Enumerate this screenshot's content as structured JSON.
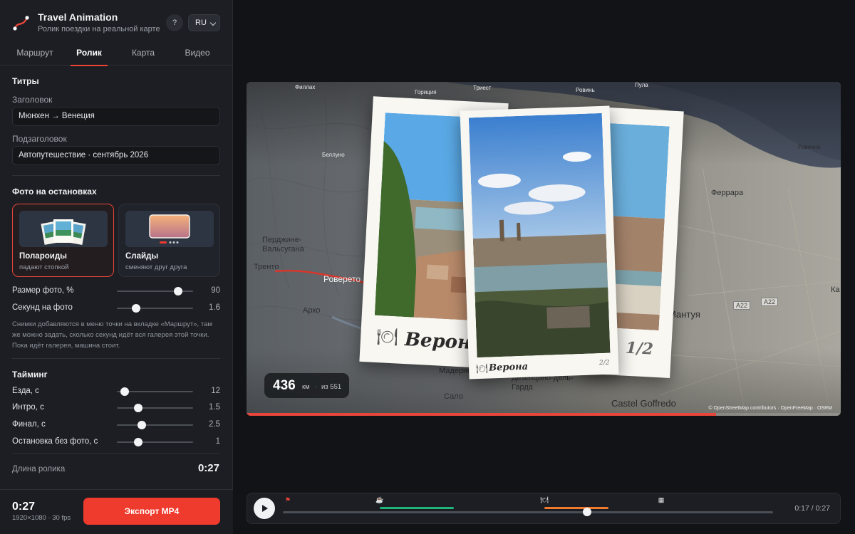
{
  "brand": {
    "title": "Travel Animation",
    "subtitle": "Ролик поездки на реальной карте",
    "help": "?",
    "lang": "RU"
  },
  "tabs": [
    {
      "label": "Маршрут",
      "active": false
    },
    {
      "label": "Ролик",
      "active": true
    },
    {
      "label": "Карта",
      "active": false
    },
    {
      "label": "Видео",
      "active": false
    }
  ],
  "titles": {
    "heading": "Титры",
    "title_label": "Заголовок",
    "title_value": "Мюнхен → Венеция",
    "subtitle_label": "Подзаголовок",
    "subtitle_value": "Автопутешествие · сентябрь 2026"
  },
  "photos": {
    "heading": "Фото на остановках",
    "modes": [
      {
        "title": "Полароиды",
        "sub": "падают стопкой",
        "selected": true
      },
      {
        "title": "Слайды",
        "sub": "сменяют друг друга",
        "selected": false
      }
    ],
    "size_label": "Размер фото, %",
    "size_value": "90",
    "size_fraction": 0.8,
    "secs_label": "Секунд на фото",
    "secs_value": "1.6",
    "secs_fraction": 0.25,
    "hint": "Снимки добавляются в меню точки на вкладке «Маршрут», там же можно задать, сколько секунд идёт вся галерея этой точки. Пока идёт галерея, машина стоит."
  },
  "timing": {
    "heading": "Тайминг",
    "rows": [
      {
        "label": "Езда, с",
        "value": "12",
        "fraction": 0.1
      },
      {
        "label": "Интро, с",
        "value": "1.5",
        "fraction": 0.28
      },
      {
        "label": "Финал, с",
        "value": "2.5",
        "fraction": 0.33
      },
      {
        "label": "Остановка без фото, с",
        "value": "1",
        "fraction": 0.28
      }
    ],
    "length_label": "Длина ролика",
    "length_value": "0:27"
  },
  "footer": {
    "time": "0:27",
    "meta": "1920×1080 · 30 fps",
    "export": "Экспорт MP4"
  },
  "preview": {
    "cities": {
      "fillach": "Филлах",
      "gorizia": "Гориция",
      "triest": "Триест",
      "rovinj": "Ровинь",
      "pula": "Пула",
      "belluno": "Беллуно",
      "ravenna": "Равенна",
      "ferrara": "Феррара",
      "pergine": "Перджине-Вальсугана",
      "trento": "Тренто",
      "rovereto": "Роверето",
      "arco": "Арко",
      "mantova": "Мантуя",
      "maderno": "Мадерно",
      "salo": "Сало",
      "desenzano": "Дезенцано-дель-Гарда",
      "castel": "Castel Goffredo",
      "ka": "Ка"
    },
    "roads": [
      "A22",
      "A22"
    ],
    "polaroids": {
      "back_caption": "Верона",
      "front_caption": "Верона",
      "front_counter": "2/2",
      "right_counter": "1/2"
    },
    "distance": {
      "value": "436",
      "unit": "км",
      "sep": "·",
      "total": "из 551"
    },
    "attribution": "© OpenStreetMap contributors · OpenFreeMap · OSRM",
    "progress_fraction": 0.79
  },
  "timeline": {
    "time": "0:17 / 0:27",
    "progress_fraction": 0.62,
    "markers": [
      {
        "icon": "flag-icon",
        "glyph": "⚑",
        "color": "#e8463a"
      },
      {
        "icon": "coffee-icon",
        "glyph": "☕",
        "color": "#d9dadd"
      },
      {
        "icon": "food-icon",
        "glyph": "🍽",
        "color": "#d9dadd"
      },
      {
        "icon": "finish-flag-icon",
        "glyph": "▦",
        "color": "#d9dadd"
      }
    ],
    "segments_colors": {
      "green": "#1fb57a",
      "orange": "#ef7a2b"
    }
  },
  "colors": {
    "accent": "#ef3b2d",
    "bg": "#111317",
    "panel": "#1c1e23"
  }
}
